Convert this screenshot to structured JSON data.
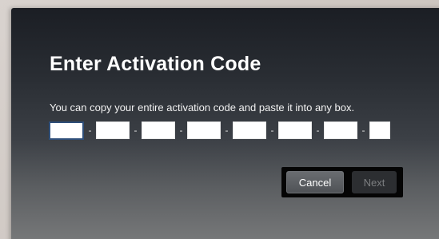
{
  "dialog": {
    "title": "Enter Activation Code",
    "instructions": "You can copy your entire activation code and paste it into any box."
  },
  "code": {
    "separator": "-",
    "box_count": 8,
    "focused_index": 0
  },
  "buttons": {
    "cancel_label": "Cancel",
    "next_label": "Next",
    "next_enabled": false
  },
  "colors": {
    "focus_border": "#2f4f7a",
    "next_disabled_text": "#7c7e80"
  }
}
